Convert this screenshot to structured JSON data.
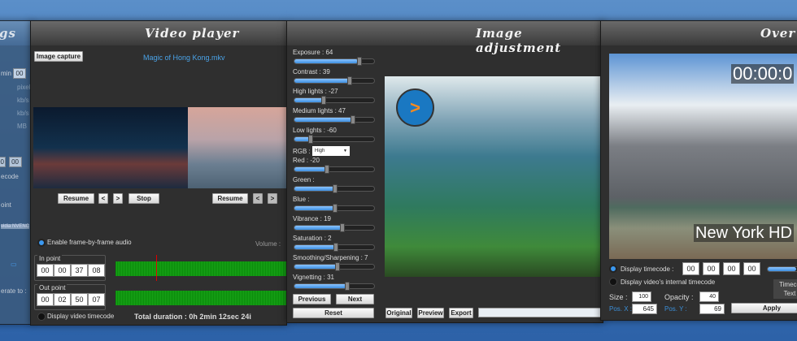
{
  "left_window": {
    "title_fragment": "gs",
    "min_label": "min",
    "min_value": "00",
    "unit_pixels": "pixels",
    "unit_kbs_1": "kb/s",
    "unit_kbs_2": "kb/s",
    "unit_mb": "MB",
    "tc_1": "00",
    "tc_2": "00",
    "timecode_fragment": "ecode",
    "point_fragment": "oint",
    "encoder_fragment": "vidia NVENC",
    "rate_fragment": "erate to :"
  },
  "video_player": {
    "title": "Video player",
    "image_capture": "Image capture",
    "filename": "Magic of Hong Kong.mkv",
    "left_controls": {
      "resume": "Resume",
      "prev": "<",
      "next": ">",
      "stop": "Stop"
    },
    "right_controls": {
      "resume": "Resume",
      "prev": "<",
      "next": ">"
    },
    "frame_audio_label": "Enable frame-by-frame audio",
    "volume_label": "Volume :",
    "in_point": {
      "label": "In point",
      "values": [
        "00",
        "00",
        "37",
        "08"
      ]
    },
    "out_point": {
      "label": "Out point",
      "values": [
        "00",
        "02",
        "50",
        "07"
      ]
    },
    "display_timecode_label": "Display video timecode",
    "total_duration": "Total duration : 0h 2min 12sec 24i"
  },
  "image_adjustment": {
    "title": "Image adjustment",
    "sliders": [
      {
        "label": "Exposure : 64",
        "value": 0.8
      },
      {
        "label": "Contrast : 39",
        "value": 0.68
      },
      {
        "label": "High lights : -27",
        "value": 0.36
      },
      {
        "label": "Medium lights : 47",
        "value": 0.72
      },
      {
        "label": "Low lights : -60",
        "value": 0.2
      },
      {
        "label": "Red : -20",
        "value": 0.4
      },
      {
        "label": "Green :",
        "value": 0.5
      },
      {
        "label": "Blue :",
        "value": 0.5
      },
      {
        "label": "Vibrance : 19",
        "value": 0.59
      },
      {
        "label": "Saturation : 2",
        "value": 0.51
      },
      {
        "label": "Smoothing/Sharpening : 7",
        "value": 0.53
      },
      {
        "label": "Vignetting : 31",
        "value": 0.65
      }
    ],
    "rgb_label": "RGB :",
    "rgb_value": "High",
    "previous": "Previous",
    "next": "Next",
    "reset": "Reset",
    "original": "Original",
    "preview": "Preview",
    "export": "Export",
    "export_progress": 0
  },
  "overlay": {
    "title": "Over",
    "timecode_overlay": "00:00:0",
    "text_overlay": "New York HD",
    "display_timecode_label": "Display timecode :",
    "timecode_values": [
      "00",
      "00",
      "00",
      "00"
    ],
    "internal_timecode_label": "Display video's internal timecode",
    "size_label": "Size :",
    "size_value": "100",
    "opacity_label": "Opacity :",
    "opacity_value": "40",
    "posx_label": "Pos. X :",
    "posx_value": "645",
    "posy_label": "Pos. Y :",
    "posy_value": "69",
    "tab_timecode": "Timeco",
    "tab_text": "Text",
    "apply": "Apply",
    "accent": "#3b98f0"
  }
}
